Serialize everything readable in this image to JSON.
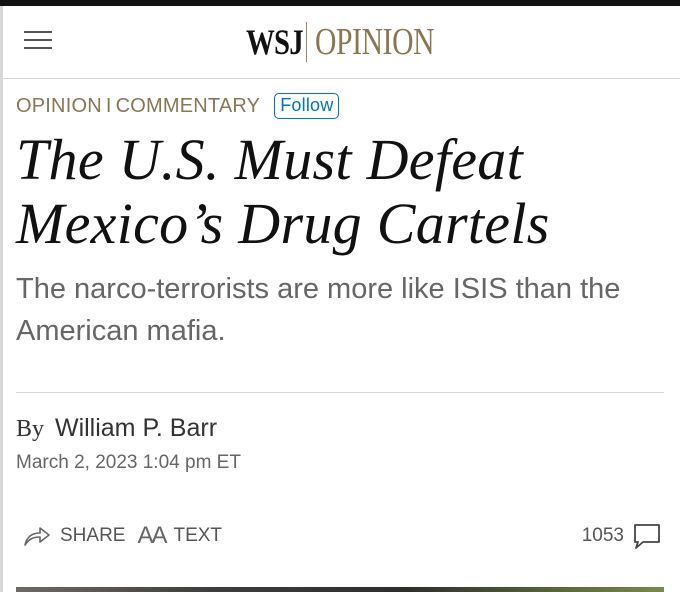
{
  "masthead": {
    "menu_icon": "hamburger-menu-icon",
    "logo_brand": "WSJ",
    "logo_section": "OPINION"
  },
  "article": {
    "section": "OPINION",
    "separator": "I",
    "category": "COMMENTARY",
    "follow_label": "Follow",
    "headline": "The U.S. Must Defeat Mexico’s Drug Cartels",
    "dek": "The narco-terrorists are more like ISIS than the American mafia.",
    "byline_prefix": "By",
    "author": "William P. Barr",
    "date": "March 2, 2023 1:04 pm ET"
  },
  "toolbar": {
    "share_label": "SHARE",
    "share_icon": "share-arrow-icon",
    "text_label": "TEXT",
    "text_icon": "text-size-icon",
    "text_glyph": "AA",
    "comment_count": "1053",
    "comment_icon": "comment-bubble-icon"
  },
  "colors": {
    "accent_opinion": "#8c7553",
    "link_blue": "#0274b6",
    "headline": "#111111"
  }
}
